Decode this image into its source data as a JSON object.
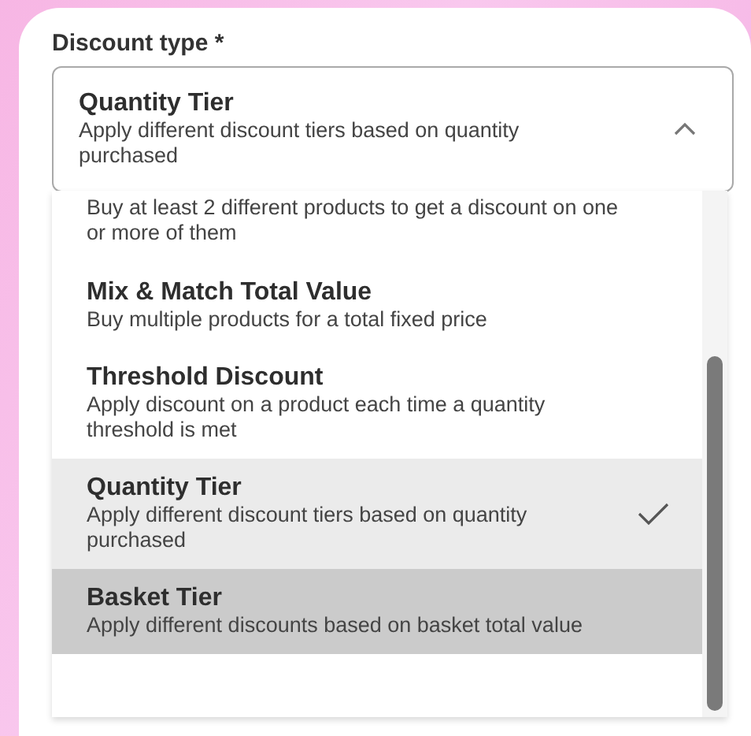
{
  "field": {
    "label": "Discount type *",
    "value_title": "Quantity Tier",
    "value_description": "Apply different discount tiers based on quantity purchased",
    "expanded": true
  },
  "options": [
    {
      "description": "Buy at least 2 different products to get a discount on one or more of them",
      "selected": false,
      "highlighted": false
    },
    {
      "title": "Mix & Match Total Value",
      "description": "Buy multiple products for a total fixed price",
      "selected": false,
      "highlighted": false
    },
    {
      "title": "Threshold Discount",
      "description": "Apply discount on a product each time a quantity threshold is met",
      "selected": false,
      "highlighted": false
    },
    {
      "title": "Quantity Tier",
      "description": "Apply different discount tiers based on quantity purchased",
      "selected": true,
      "highlighted": false
    },
    {
      "title": "Basket Tier",
      "description": "Apply different discounts based on basket total value",
      "selected": false,
      "highlighted": true
    }
  ]
}
